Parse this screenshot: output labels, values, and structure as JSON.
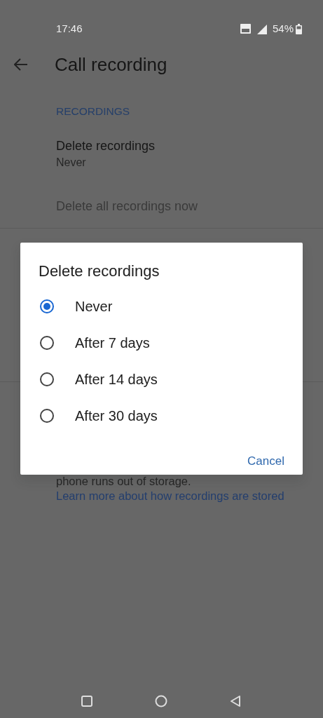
{
  "status_bar": {
    "time": "17:46",
    "battery": "54%"
  },
  "header": {
    "title": "Call recording"
  },
  "section": {
    "heading": "RECORDINGS"
  },
  "settings": [
    {
      "title": "Delete recordings",
      "value": "Never"
    }
  ],
  "action": {
    "label": "Delete all recordings now",
    "disabled": true
  },
  "footer_text": {
    "text": "phone runs out of storage.",
    "link": "Learn more about how recordings are stored"
  },
  "dialog": {
    "title": "Delete recordings",
    "options": [
      {
        "label": "Never",
        "selected": true
      },
      {
        "label": "After 7 days",
        "selected": false
      },
      {
        "label": "After 14 days",
        "selected": false
      },
      {
        "label": "After 30 days",
        "selected": false
      }
    ],
    "buttons": [
      "Cancel"
    ]
  }
}
